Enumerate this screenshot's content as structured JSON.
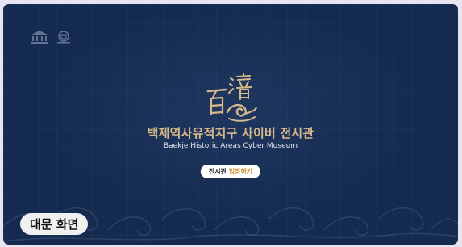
{
  "hero": {
    "title": "백제역사유적지구 사이버 전시관",
    "subtitle": "Baekje Historic Areas Cyber Museum",
    "emblem_icon": "baekje-calligraphy-emblem",
    "enter_button": {
      "prefix": "전시관",
      "accent": "입장하기"
    }
  },
  "logos": [
    "unesco-logo",
    "world-heritage-logo"
  ],
  "caption": "대문 화면",
  "colors": {
    "background": "#142a4f",
    "title": "#d8b78a",
    "button_accent": "#c98a2a",
    "page": "#e9e4f1"
  }
}
